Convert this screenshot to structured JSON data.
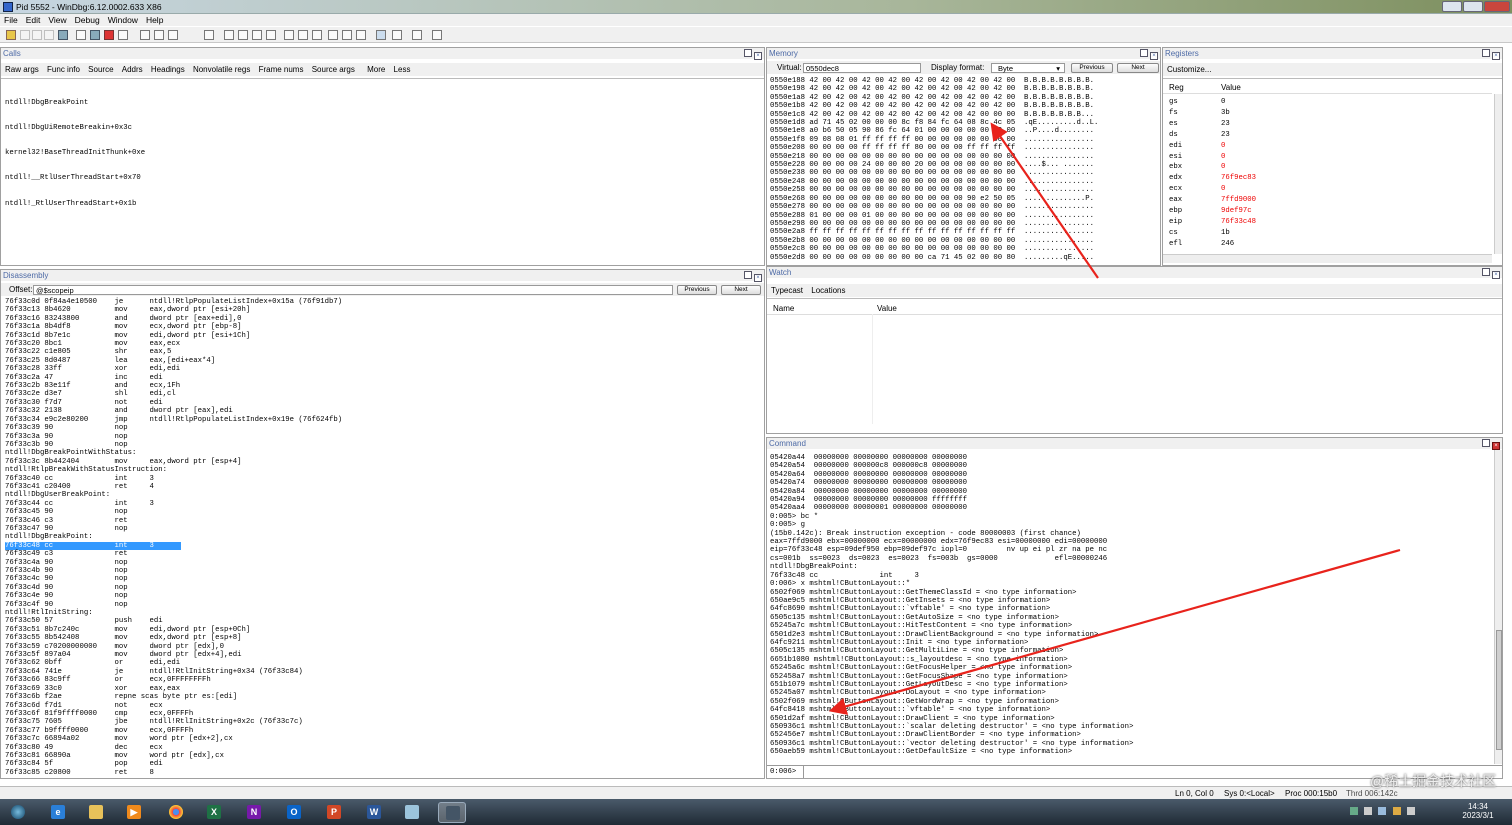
{
  "window": {
    "title": "Pid 5552 - WinDbg:6.12.0002.633 X86"
  },
  "menu": [
    "File",
    "Edit",
    "View",
    "Debug",
    "Window",
    "Help"
  ],
  "calls": {
    "title": "Calls",
    "options": [
      "Raw args",
      "Func info",
      "Source",
      "Addrs",
      "Headings",
      "Nonvolatile regs",
      "Frame nums",
      "Source args",
      "More",
      "Less"
    ],
    "frames": [
      "ntdll!DbgBreakPoint",
      "ntdll!DbgUiRemoteBreakin+0x3c",
      "kernel32!BaseThreadInitThunk+0xe",
      "ntdll!__RtlUserThreadStart+0x70",
      "ntdll!_RtlUserThreadStart+0x1b"
    ]
  },
  "memory": {
    "title": "Memory",
    "virtual_label": "Virtual:",
    "virtual_value": "0550dec8",
    "format_label": "Display format:",
    "format_value": "Byte",
    "previous": "Previous",
    "next": "Next",
    "lines": [
      "0550e188 42 00 42 00 42 00 42 00 42 00 42 00 42 00 42 00  B.B.B.B.B.B.B.B.",
      "0550e198 42 00 42 00 42 00 42 00 42 00 42 00 42 00 42 00  B.B.B.B.B.B.B.B.",
      "0550e1a8 42 00 42 00 42 00 42 00 42 00 42 00 42 00 42 00  B.B.B.B.B.B.B.B.",
      "0550e1b8 42 00 42 00 42 00 42 00 42 00 42 00 42 00 42 00  B.B.B.B.B.B.B.B.",
      "0550e1c8 42 00 42 00 42 00 42 00 42 00 42 00 42 00 00 00  B.B.B.B.B.B.B...",
      "0550e1d8 ad 71 45 02 00 00 00 8c f8 84 fc 64 08 8c 4c 05  .qE.........d..L.",
      "0550e1e8 a0 b6 50 05 90 86 fc 64 01 00 00 00 00 00 00 00  ..P....d........",
      "0550e1f8 09 08 08 01 ff ff ff ff 00 00 00 00 00 00 00 00  ................",
      "0550e208 00 00 00 00 ff ff ff ff 80 00 00 00 ff ff ff ff  ................",
      "0550e218 00 00 00 00 00 00 00 00 00 00 00 00 00 00 00 00  ................",
      "0550e228 00 00 00 00 24 00 00 00 20 00 00 00 00 00 00 00  ....$... .......",
      "0550e238 00 00 00 00 00 00 00 00 00 00 00 00 00 00 00 00  ................",
      "0550e248 00 00 00 00 00 00 00 00 00 00 00 00 00 00 00 00  ................",
      "0550e258 00 00 00 00 00 00 00 00 00 00 00 00 00 00 00 00  ................",
      "0550e268 00 00 00 00 00 00 00 00 00 00 00 00 90 e2 50 05  ..............P.",
      "0550e278 00 00 00 00 00 00 00 00 00 00 00 00 00 00 00 00  ................",
      "0550e288 01 00 00 00 01 00 00 00 00 00 00 00 00 00 00 00  ................",
      "0550e298 00 00 00 00 00 00 00 00 00 00 00 00 00 00 00 00  ................",
      "0550e2a8 ff ff ff ff ff ff ff ff ff ff ff ff ff ff ff ff  ................",
      "0550e2b8 00 00 00 00 00 00 00 00 00 00 00 00 00 00 00 00  ................",
      "0550e2c8 00 00 00 00 00 00 00 00 00 00 00 00 00 00 00 00  ................",
      "0550e2d8 00 00 00 00 00 00 00 00 00 ca 71 45 02 00 00 80  .........qE....."
    ]
  },
  "registers": {
    "title": "Registers",
    "customize": "Customize...",
    "col_reg": "Reg",
    "col_value": "Value",
    "rows": [
      [
        "gs",
        "0",
        false
      ],
      [
        "fs",
        "3b",
        false
      ],
      [
        "es",
        "23",
        false
      ],
      [
        "ds",
        "23",
        false
      ],
      [
        "edi",
        "0",
        true
      ],
      [
        "esi",
        "0",
        true
      ],
      [
        "ebx",
        "0",
        true
      ],
      [
        "edx",
        "76f9ec83",
        true
      ],
      [
        "ecx",
        "0",
        true
      ],
      [
        "eax",
        "7ffd9000",
        true
      ],
      [
        "ebp",
        "9def97c",
        true
      ],
      [
        "eip",
        "76f33c48",
        true
      ],
      [
        "cs",
        "1b",
        false
      ],
      [
        "efl",
        "246",
        false
      ]
    ]
  },
  "disassembly": {
    "title": "Disassembly",
    "offset_label": "Offset:",
    "offset_value": "@$scopeip",
    "previous": "Previous",
    "next": "Next",
    "lines": [
      "76f33c0d 0f84a4e10500    je      ntdll!RtlpPopulateListIndex+0x15a (76f91db7)",
      "76f33c13 8b4620          mov     eax,dword ptr [esi+20h]",
      "76f33c16 83243800        and     dword ptr [eax+edi],0",
      "76f33c1a 8b4df8          mov     ecx,dword ptr [ebp-8]",
      "76f33c1d 8b7e1c          mov     edi,dword ptr [esi+1Ch]",
      "76f33c20 8bc1            mov     eax,ecx",
      "76f33c22 c1e805          shr     eax,5",
      "76f33c25 8d0487          lea     eax,[edi+eax*4]",
      "76f33c28 33ff            xor     edi,edi",
      "76f33c2a 47              inc     edi",
      "76f33c2b 83e11f          and     ecx,1Fh",
      "76f33c2e d3e7            shl     edi,cl",
      "76f33c30 f7d7            not     edi",
      "76f33c32 2138            and     dword ptr [eax],edi",
      "76f33c34 e9c2e80200      jmp     ntdll!RtlpPopulateListIndex+0x19e (76f624fb)",
      "76f33c39 90              nop",
      "76f33c3a 90              nop",
      "76f33c3b 90              nop",
      "ntdll!DbgBreakPointWithStatus:",
      "76f33c3c 8b442404        mov     eax,dword ptr [esp+4]",
      "ntdll!RtlpBreakWithStatusInstruction:",
      "76f33c40 cc              int     3",
      "76f33c41 c20400          ret     4",
      "ntdll!DbgUserBreakPoint:",
      "76f33c44 cc              int     3",
      "76f33c45 90              nop",
      "76f33c46 c3              ret",
      "76f33c47 90              nop",
      "ntdll!DbgBreakPoint:",
      "76f33c48 cc              int     3",
      "76f33c49 c3              ret",
      "76f33c4a 90              nop",
      "76f33c4b 90              nop",
      "76f33c4c 90              nop",
      "76f33c4d 90              nop",
      "76f33c4e 90              nop",
      "76f33c4f 90              nop",
      "ntdll!RtlInitString:",
      "76f33c50 57              push    edi",
      "76f33c51 8b7c240c        mov     edi,dword ptr [esp+0Ch]",
      "76f33c55 8b542408        mov     edx,dword ptr [esp+8]",
      "76f33c59 c70200000000    mov     dword ptr [edx],0",
      "76f33c5f 897a04          mov     dword ptr [edx+4],edi",
      "76f33c62 0bff            or      edi,edi",
      "76f33c64 741e            je      ntdll!RtlInitString+0x34 (76f33c84)",
      "76f33c66 83c9ff          or      ecx,0FFFFFFFFh",
      "76f33c69 33c0            xor     eax,eax",
      "76f33c6b f2ae            repne scas byte ptr es:[edi]",
      "76f33c6d f7d1            not     ecx",
      "76f33c6f 81f9ffff0000    cmp     ecx,0FFFFh",
      "76f33c75 7605            jbe     ntdll!RtlInitString+0x2c (76f33c7c)",
      "76f33c77 b9ffff0000      mov     ecx,0FFFFh",
      "76f33c7c 66894a02        mov     word ptr [edx+2],cx",
      "76f33c80 49              dec     ecx",
      "76f33c81 66890a          mov     word ptr [edx],cx",
      "76f33c84 5f              pop     edi",
      "76f33c85 c20800          ret     8"
    ],
    "highlight_index": 29
  },
  "watch": {
    "title": "Watch",
    "typecast": "Typecast",
    "locations": "Locations",
    "col_name": "Name",
    "col_value": "Value"
  },
  "command": {
    "title": "Command",
    "prompt": "0:006>",
    "lines": [
      "05420a44  00000000 00000000 00000000 00000000",
      "05420a54  00000000 000000c8 000000c8 00000000",
      "05420a64  00000000 00000000 00000000 00000000",
      "05420a74  00000000 00000000 00000000 00000000",
      "05420a84  00000000 00000000 00000000 00000000",
      "05420a94  00000000 00000000 00000000 ffffffff",
      "05420aa4  00000000 00000001 00000000 00000000",
      "0:005> bc *",
      "0:005> g",
      "(15b0.142c): Break instruction exception - code 80000003 (first chance)",
      "eax=7ffd9000 ebx=00000000 ecx=00000000 edx=76f9ec83 esi=00000000 edi=00000000",
      "eip=76f33c48 esp=09def950 ebp=09def97c iopl=0         nv up ei pl zr na pe nc",
      "cs=001b  ss=0023  ds=0023  es=0023  fs=003b  gs=0000             efl=00000246",
      "ntdll!DbgBreakPoint:",
      "76f33c48 cc              int     3",
      "0:006> x mshtml!CButtonLayout::*",
      "6502f069 mshtml!CButtonLayout::GetThemeClassId = <no type information>",
      "650ae9c5 mshtml!CButtonLayout::GetInsets = <no type information>",
      "64fc8690 mshtml!CButtonLayout::`vftable' = <no type information>",
      "6505c135 mshtml!CButtonLayout::GetAutoSize = <no type information>",
      "65245a7c mshtml!CButtonLayout::HitTestContent = <no type information>",
      "6501d2e3 mshtml!CButtonLayout::DrawClientBackground = <no type information>",
      "64fc9211 mshtml!CButtonLayout::Init = <no type information>",
      "6505c135 mshtml!CButtonLayout::GetMultiLine = <no type information>",
      "6651b1080 mshtml!CButtonLayout::s_layoutdesc = <no type information>",
      "65245a6c mshtml!CButtonLayout::GetFocusHelper = <no type information>",
      "652458a7 mshtml!CButtonLayout::GetFocusShape = <no type information>",
      "651b1079 mshtml!CButtonLayout::GetLayoutDesc = <no type information>",
      "65245a07 mshtml!CButtonLayout::DoLayout = <no type information>",
      "6502f069 mshtml!CButtonLayout::GetWordWrap = <no type information>",
      "64fc8418 mshtml!CButtonLayout::`vftable' = <no type information>",
      "6501d2af mshtml!CButtonLayout::DrawClient = <no type information>",
      "650936c1 mshtml!CButtonLayout::`scalar deleting destructor' = <no type information>",
      "652456e7 mshtml!CButtonLayout::DrawClientBorder = <no type information>",
      "650936c1 mshtml!CButtonLayout::`vector deleting destructor' = <no type information>",
      "650aeb59 mshtml!CButtonLayout::GetDefaultSize = <no type information>"
    ]
  },
  "status": {
    "position": "Ln 0, Col 0",
    "sys": "Sys 0:<Local>",
    "proc": "Proc 000:15b0",
    "thrd": "Thrd 006:142c"
  },
  "tray": {
    "time": "14:34",
    "date": "2023/3/1",
    "watermark": "@稀土掘金技术社区"
  },
  "colors": {
    "annotation_arrow": "#e8231c",
    "register_changed": "#e00000",
    "highlight": "#3399ff"
  }
}
